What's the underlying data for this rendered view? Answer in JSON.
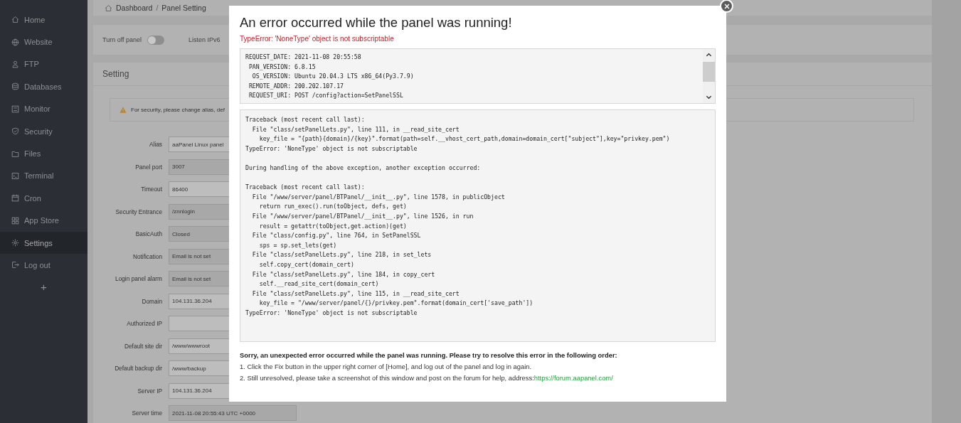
{
  "sidebar": {
    "items": [
      {
        "label": "Home",
        "selected": false
      },
      {
        "label": "Website",
        "selected": false
      },
      {
        "label": "FTP",
        "selected": false
      },
      {
        "label": "Databases",
        "selected": false
      },
      {
        "label": "Monitor",
        "selected": false
      },
      {
        "label": "Security",
        "selected": false
      },
      {
        "label": "Files",
        "selected": false
      },
      {
        "label": "Terminal",
        "selected": false
      },
      {
        "label": "Cron",
        "selected": false
      },
      {
        "label": "App Store",
        "selected": false
      },
      {
        "label": "Settings",
        "selected": true
      },
      {
        "label": "Log out",
        "selected": false
      }
    ],
    "add_button": "+"
  },
  "breadcrumb": [
    "Dashboard",
    "/",
    "Panel Setting"
  ],
  "toggles": [
    {
      "label": "Turn off panel",
      "on": false
    },
    {
      "label": "Listen IPv6"
    }
  ],
  "setting_card": {
    "title": "Setting",
    "warning": "For security, please change alias, def",
    "fields": [
      {
        "label": "Alias",
        "value": "aaPanel Linux panel",
        "readonly": false
      },
      {
        "label": "Panel port",
        "value": "3007",
        "readonly": true
      },
      {
        "label": "Timeout",
        "value": "86400",
        "readonly": false
      },
      {
        "label": "Security Entrance",
        "value": "/znnlogin",
        "readonly": true
      },
      {
        "label": "BasicAuth",
        "value": "Closed",
        "readonly": true
      },
      {
        "label": "Notification",
        "value": "Email is not set",
        "readonly": true
      },
      {
        "label": "Login panel alarm",
        "value": "Email is not set",
        "readonly": true
      },
      {
        "label": "Domain",
        "value": "104.131.36.204",
        "readonly": false
      },
      {
        "label": "Authorized IP",
        "readonly": false
      },
      {
        "label": "Default site dir",
        "value": "/www/wwwroot",
        "readonly": false
      },
      {
        "label": "Default backup dir",
        "value": "/www/backup",
        "readonly": false
      },
      {
        "label": "Server IP",
        "value": "104.131.36.204",
        "readonly": false
      },
      {
        "label": "Server time",
        "value": "2021-11-08 20:55:43 UTC +0000",
        "readonly": true
      }
    ]
  },
  "error_dialog": {
    "title": "An error occurred while the panel was running!",
    "error": "TypeError: 'NoneType' object is not subscriptable",
    "request_info": [
      "REQUEST_DATE: 2021-11-08 20:55:58",
      " PAN_VERSION: 6.8.15",
      "  OS_VERSION: Ubuntu 20.04.3 LTS x86_64(Py3.7.9)",
      " REMOTE_ADDR: 200.202.107.17",
      " REQUEST_URI: POST /config?action=SetPanelSSL"
    ],
    "traceback": [
      [
        "Traceback (most recent call last):",
        "  File \"class/setPanelLets.py\", line 111, in __read_site_cert",
        "    key_file = \"{path}{domain}/{key}\".format(path=self.__vhost_cert_path,domain=domain_cert[\"subject\"],key=\"privkey.pem\")",
        "TypeError: 'NoneType' object is not subscriptable"
      ],
      [
        "During handling of the above exception, another exception occurred:"
      ],
      [
        "Traceback (most recent call last):",
        "  File \"/www/server/panel/BTPanel/__init__.py\", line 1578, in publicObject",
        "    return run_exec().run(toObject, defs, get)",
        "  File \"/www/server/panel/BTPanel/__init__.py\", line 1526, in run",
        "    result = getattr(toObject,get.action)(get)",
        "  File \"class/config.py\", line 764, in SetPanelSSL",
        "    sps = sp.set_lets(get)",
        "  File \"class/setPanelLets.py\", line 218, in set_lets",
        "    self.copy_cert(domain_cert)",
        "  File \"class/setPanelLets.py\", line 184, in copy_cert",
        "    self.__read_site_cert(domain_cert)",
        "  File \"class/setPanelLets.py\", line 115, in __read_site_cert",
        "    key_file = \"/www/server/panel/{}/privkey.pem\".format(domain_cert['save_path'])",
        "TypeError: 'NoneType' object is not subscriptable"
      ]
    ],
    "help_heading": "Sorry, an unexpected error occurred while the panel was running. Please try to resolve this error in the following order:",
    "help_steps": [
      {
        "text": "1. Click the Fix button in the upper right corner of [Home], and log out of the panel and log in again."
      },
      {
        "text": "2. Still unresolved, please take a screenshot of this window and post on the forum for help, address:",
        "link": "https://forum.aapanel.com/"
      }
    ]
  }
}
